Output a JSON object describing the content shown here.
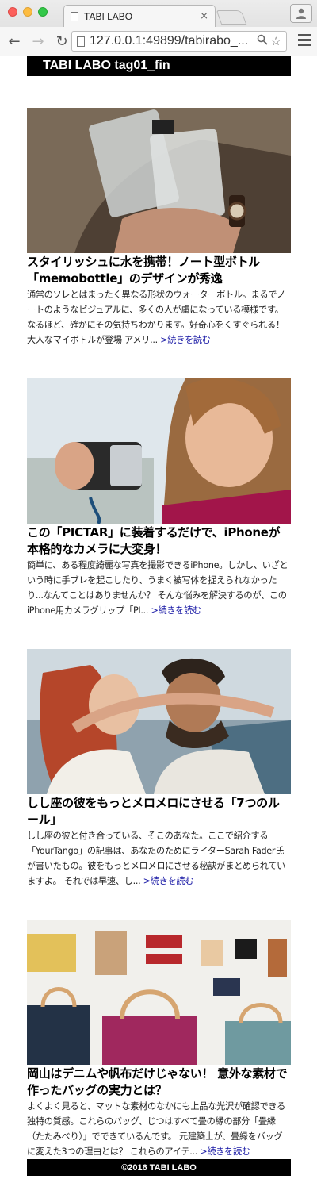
{
  "browser": {
    "tab_title": "TABI LABO",
    "tab_close": "×",
    "url": "127.0.0.1:49899/tabirabo_...",
    "back": "←",
    "forward": "→",
    "reload": "↻",
    "search": "🔍",
    "star": "☆"
  },
  "site": {
    "header_title": "TABI LABO tag01_fin",
    "footer": "©2016 TABI LABO"
  },
  "articles": [
    {
      "title": "スタイリッシュに水を携帯！ノート型ボトル「memobottle」のデザインが秀逸",
      "excerpt": "通常のソレとはまったく異なる形状のウォーターボトル。まるでノートのようなビジュアルに、多くの人が虜になっている模様です。なるほど、確かにその気持ちわかります。好奇心をくすぐられる！大人なマイボトルが登場 アメリ... ",
      "more": ">続きを読む"
    },
    {
      "title": "この「PICTAR」に装着するだけで、iPhoneが本格的なカメラに大変身！",
      "excerpt": "簡単に、ある程度綺麗な写真を撮影できるiPhone。しかし、いざという時に手ブレを起こしたり、うまく被写体を捉えられなかったり...なんてことはありませんか？ そんな悩みを解決するのが、このiPhone用カメラグリップ「PI... ",
      "more": ">続きを読む"
    },
    {
      "title": "しし座の彼をもっとメロメロにさせる「7つのルール」",
      "excerpt": "しし座の彼と付き合っている、そこのあなた。ここで紹介する「YourTango」の記事は、あなたのためにライターSarah Fader氏が書いたもの。彼をもっとメロメロにさせる秘訣がまとめられていますよ。 それでは早速、し... ",
      "more": ">続きを読む"
    },
    {
      "title": "岡山はデニムや帆布だけじゃない！ 意外な素材で作ったバッグの実力とは？",
      "excerpt": "よくよく見ると、マットな素材のなかにも上品な光沢が確認できる独特の質感。これらのバッグ、じつはすべて畳の縁の部分「畳縁（たたみべり）」でできているんです。 元建築士が、畳縁をバッグに変えた3つの理由とは？ これらのアイテ... ",
      "more": ">続きを読む"
    }
  ]
}
